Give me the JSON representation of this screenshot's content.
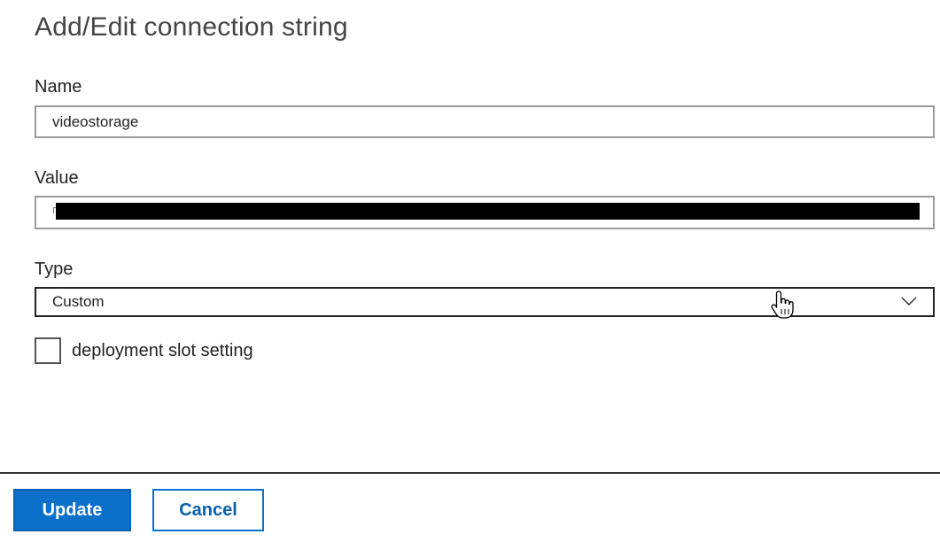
{
  "dialog": {
    "title": "Add/Edit connection string"
  },
  "form": {
    "name": {
      "label": "Name",
      "value": "videostorage"
    },
    "value": {
      "label": "Value"
    },
    "type": {
      "label": "Type",
      "selected": "Custom"
    },
    "deployment_slot": {
      "label": "deployment slot setting",
      "checked": false
    }
  },
  "actions": {
    "update_label": "Update",
    "cancel_label": "Cancel"
  },
  "icons": {
    "dropdown": "chevron-down-icon",
    "cursor": "hand-pointer-cursor"
  },
  "colors": {
    "primary": "#0a70c9",
    "text": "#222222"
  }
}
